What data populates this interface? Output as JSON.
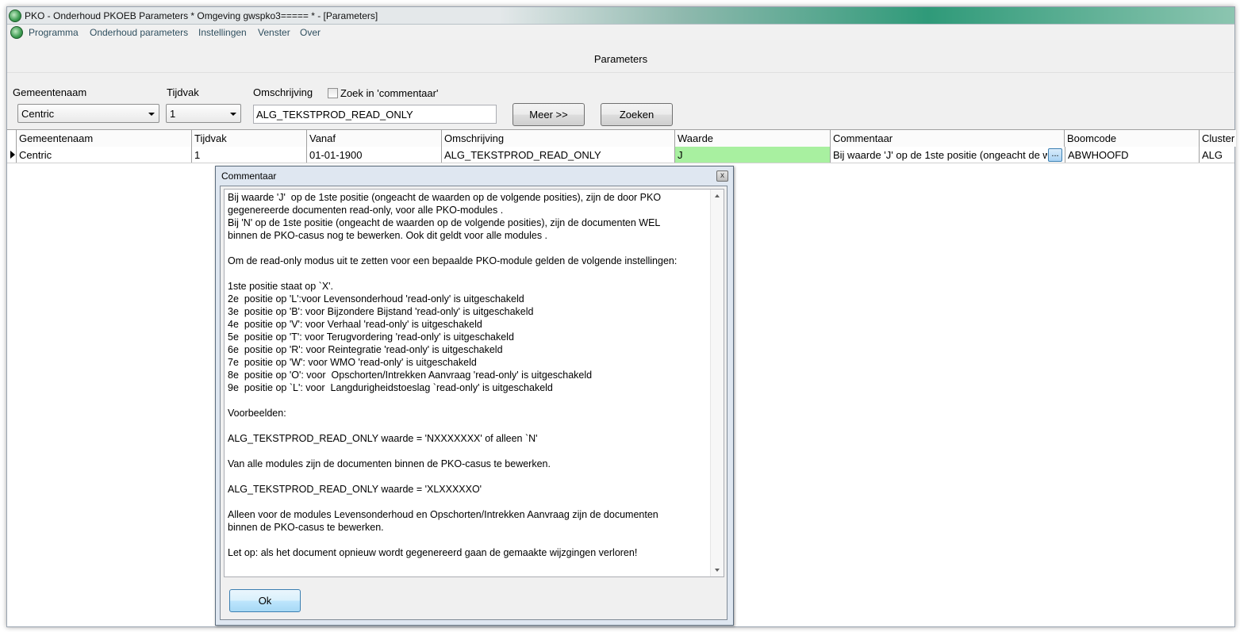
{
  "window": {
    "title": "PKO - Onderhoud PKOEB Parameters * Omgeving gwspko3===== * - [Parameters]"
  },
  "menu": [
    "Programma",
    "Onderhoud parameters",
    "Instellingen",
    "Venster",
    "Over"
  ],
  "form": {
    "title": "Parameters"
  },
  "search": {
    "gemeentenaam_label": "Gemeentenaam",
    "gemeentenaam_value": "Centric",
    "tijdvak_label": "Tijdvak",
    "tijdvak_value": "1",
    "omschrijving_label": "Omschrijving",
    "omschrijving_value": "ALG_TEKSTPROD_READ_ONLY",
    "zoek_commentaar_label": "Zoek in 'commentaar'",
    "zoek_commentaar_checked": false,
    "meer_button": "Meer >>",
    "zoeken_button": "Zoeken"
  },
  "grid": {
    "columns": [
      "Gemeentenaam",
      "Tijdvak",
      "Vanaf",
      "Omschrijving",
      "Waarde",
      "Commentaar",
      "Boomcode",
      "Cluster"
    ],
    "rows": [
      {
        "gemeentenaam": "Centric",
        "tijdvak": "1",
        "vanaf": "01-01-1900",
        "omschrijving": "ALG_TEKSTPROD_READ_ONLY",
        "waarde": "J",
        "commentaar": "Bij waarde 'J'  op de 1ste positie (ongeacht de waarden op de volgende posities)",
        "boomcode": "ABWHOOFD",
        "cluster": "ALG"
      }
    ],
    "ellipsis_label": "...",
    "highlight_color": "#a8f0a0"
  },
  "dialog": {
    "title": "Commentaar",
    "close_symbol": "x",
    "text": "Bij waarde 'J'  op de 1ste positie (ongeacht de waarden op de volgende posities), zijn de door PKO\ngegenereerde documenten read-only, voor alle PKO-modules .\nBij 'N' op de 1ste positie (ongeacht de waarden op de volgende posities), zijn de documenten WEL\nbinnen de PKO-casus nog te bewerken. Ook dit geldt voor alle modules .\n\nOm de read-only modus uit te zetten voor een bepaalde PKO-module gelden de volgende instellingen:\n\n1ste positie staat op `X'.\n2e  positie op 'L':voor Levensonderhoud 'read-only' is uitgeschakeld\n3e  positie op 'B': voor Bijzondere Bijstand 'read-only' is uitgeschakeld\n4e  positie op 'V': voor Verhaal 'read-only' is uitgeschakeld\n5e  positie op 'T': voor Terugvordering 'read-only' is uitgeschakeld\n6e  positie op 'R': voor Reintegratie 'read-only' is uitgeschakeld\n7e  positie op 'W': voor WMO 'read-only' is uitgeschakeld\n8e  positie op 'O': voor  Opschorten/Intrekken Aanvraag 'read-only' is uitgeschakeld\n9e  positie op `L': voor  Langdurigheidstoeslag `read-only' is uitgeschakeld\n\nVoorbeelden:\n\nALG_TEKSTPROD_READ_ONLY waarde = 'NXXXXXXX' of alleen `N'\n\nVan alle modules zijn de documenten binnen de PKO-casus te bewerken.\n\nALG_TEKSTPROD_READ_ONLY waarde = 'XLXXXXXO'\n\nAlleen voor de modules Levensonderhoud en Opschorten/Intrekken Aanvraag zijn de documenten\nbinnen de PKO-casus te bewerken.\n\nLet op: als het document opnieuw wordt gegenereerd gaan de gemaakte wijzgingen verloren!",
    "ok_button": "Ok"
  }
}
